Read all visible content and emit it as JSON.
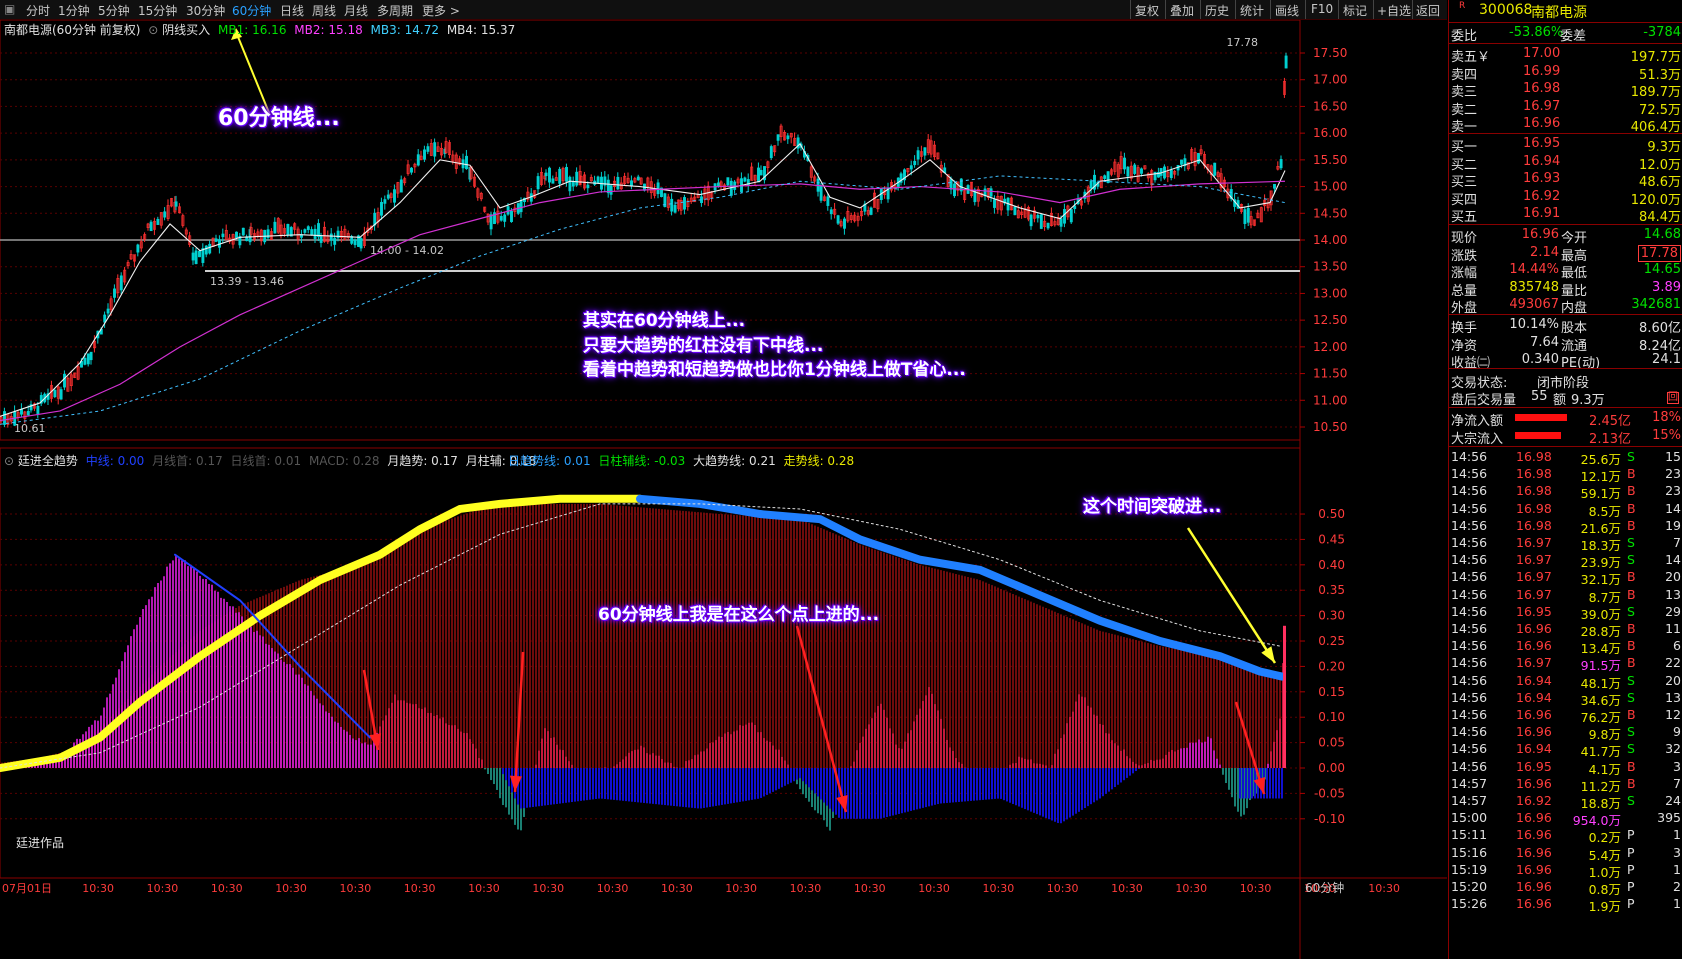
{
  "toolbar": {
    "periods": [
      "分时",
      "1分钟",
      "5分钟",
      "15分钟",
      "30分钟",
      "60分钟",
      "日线",
      "周线",
      "月线",
      "多周期",
      "更多 >"
    ],
    "active": "60分钟",
    "right": [
      "复权",
      "叠加",
      "历史",
      "统计",
      "画线",
      "F10",
      "标记",
      "+自选",
      "返回"
    ]
  },
  "main": {
    "title": "南都电源(60分钟 前复权)",
    "indicator": "阴线买入",
    "mb1": "MB1: 16.16",
    "mb2": "MB2: 15.18",
    "mb3": "MB3: 14.72",
    "mb4": "MB4: 15.37",
    "high_label": "17.78",
    "low_label": "10.61",
    "level1": "14.00 - 14.02",
    "level2": "13.39 - 13.46",
    "price_axis": [
      "17.50",
      "17.00",
      "16.50",
      "16.00",
      "15.50",
      "15.00",
      "14.50",
      "14.00",
      "13.50",
      "13.00",
      "12.50",
      "12.00",
      "11.50",
      "11.00",
      "10.50"
    ]
  },
  "sub": {
    "name": "廷进全趋势",
    "legend_dim": [
      "中线: 0.00",
      "月线首: 0.17",
      "日线首: 0.01",
      "MACD: 0.28"
    ],
    "legend1": "月趋势: 0.17",
    "legend2": "月柱辅: 0.18",
    "legend3": "日趋势线: 0.01",
    "legend4": "日柱辅线: -0.03",
    "legend5": "大趋势线: 0.21",
    "legend6": "走势线: 0.28",
    "axis": [
      "0.50",
      "0.45",
      "0.40",
      "0.35",
      "0.30",
      "0.25",
      "0.20",
      "0.15",
      "0.10",
      "0.05",
      "0.00",
      "-0.05",
      "-0.10"
    ],
    "watermark": "廷进作品"
  },
  "xaxis": {
    "labels": [
      "07月01日",
      "10:30",
      "10:30",
      "10:30",
      "10:30",
      "10:30",
      "10:30",
      "10:30",
      "10:30",
      "10:30",
      "10:30",
      "10:30",
      "10:30",
      "10:30",
      "10:30",
      "10:30",
      "10:30",
      "10:30",
      "10:30",
      "10:30",
      "10:30",
      "10:30"
    ],
    "period": "60分钟"
  },
  "annotations": {
    "a1": "60分钟线...",
    "a2": "其实在60分钟线上...",
    "a3": "只要大趋势的红柱没有下中线...",
    "a4": "看着中趋势和短趋势做也比你1分钟线上做T省心...",
    "a5": "60分钟线上我是在这么个点上进的...",
    "a6": "这个时间突破进..."
  },
  "stock": {
    "code": "300068",
    "name": "南都电源",
    "weibi_label": "委比",
    "weibi": "-53.86%",
    "weicha_label": "委差",
    "weicha": "-3784",
    "asks": [
      {
        "label": "卖五￥",
        "price": "17.00",
        "vol": "197.7万"
      },
      {
        "label": "卖四",
        "price": "16.99",
        "vol": "51.3万"
      },
      {
        "label": "卖三",
        "price": "16.98",
        "vol": "189.7万"
      },
      {
        "label": "卖二",
        "price": "16.97",
        "vol": "72.5万"
      },
      {
        "label": "卖一",
        "price": "16.96",
        "vol": "406.4万"
      }
    ],
    "bids": [
      {
        "label": "买一",
        "price": "16.95",
        "vol": "9.3万"
      },
      {
        "label": "买二",
        "price": "16.94",
        "vol": "12.0万"
      },
      {
        "label": "买三",
        "price": "16.93",
        "vol": "48.6万"
      },
      {
        "label": "买四",
        "price": "16.92",
        "vol": "120.0万"
      },
      {
        "label": "买五",
        "price": "16.91",
        "vol": "84.4万"
      }
    ],
    "quote": [
      {
        "l1": "现价",
        "v1": "16.96",
        "l2": "今开",
        "v2": "14.68"
      },
      {
        "l1": "涨跌",
        "v1": "2.14",
        "l2": "最高",
        "v2": "17.78"
      },
      {
        "l1": "涨幅",
        "v1": "14.44%",
        "l2": "最低",
        "v2": "14.65"
      },
      {
        "l1": "总量",
        "v1": "835748",
        "l2": "量比",
        "v2": "3.89"
      },
      {
        "l1": "外盘",
        "v1": "493067",
        "l2": "内盘",
        "v2": "342681"
      }
    ],
    "fund": [
      {
        "l1": "换手",
        "v1": "10.14%",
        "l2": "股本",
        "v2": "8.60亿"
      },
      {
        "l1": "净资",
        "v1": "7.64",
        "l2": "流通",
        "v2": "8.24亿"
      },
      {
        "l1": "收益㈡",
        "v1": "0.340",
        "l2": "PE(动)",
        "v2": "24.1"
      }
    ],
    "status_label": "交易状态:",
    "status": "闭市阶段",
    "after_label": "盘后交易量",
    "after_vol": "55",
    "after_amt_label": "额",
    "after_amt": "9.3万",
    "flow": [
      {
        "label": "净流入额",
        "value": "2.45亿",
        "pct": "18%"
      },
      {
        "label": "大宗流入",
        "value": "2.13亿",
        "pct": "15%"
      }
    ],
    "ticks": [
      [
        "14:56",
        "16.98",
        "25.6万",
        "S",
        "15"
      ],
      [
        "14:56",
        "16.98",
        "12.1万",
        "B",
        "23"
      ],
      [
        "14:56",
        "16.98",
        "59.1万",
        "B",
        "23"
      ],
      [
        "14:56",
        "16.98",
        "8.5万",
        "B",
        "14"
      ],
      [
        "14:56",
        "16.98",
        "21.6万",
        "B",
        "19"
      ],
      [
        "14:56",
        "16.97",
        "18.3万",
        "S",
        "7"
      ],
      [
        "14:56",
        "16.97",
        "23.9万",
        "S",
        "14"
      ],
      [
        "14:56",
        "16.97",
        "32.1万",
        "B",
        "20"
      ],
      [
        "14:56",
        "16.97",
        "8.7万",
        "B",
        "13"
      ],
      [
        "14:56",
        "16.95",
        "39.0万",
        "S",
        "29"
      ],
      [
        "14:56",
        "16.96",
        "28.8万",
        "B",
        "11"
      ],
      [
        "14:56",
        "16.96",
        "13.4万",
        "B",
        "6"
      ],
      [
        "14:56",
        "16.97",
        "91.5万",
        "B",
        "22"
      ],
      [
        "14:56",
        "16.94",
        "48.1万",
        "S",
        "20"
      ],
      [
        "14:56",
        "16.94",
        "34.6万",
        "S",
        "13"
      ],
      [
        "14:56",
        "16.96",
        "76.2万",
        "B",
        "12"
      ],
      [
        "14:56",
        "16.96",
        "9.8万",
        "S",
        "9"
      ],
      [
        "14:56",
        "16.94",
        "41.7万",
        "S",
        "32"
      ],
      [
        "14:56",
        "16.95",
        "4.1万",
        "B",
        "3"
      ],
      [
        "14:57",
        "16.96",
        "11.2万",
        "B",
        "7"
      ],
      [
        "14:57",
        "16.92",
        "18.8万",
        "S",
        "24"
      ],
      [
        "15:00",
        "16.96",
        "954.0万",
        "",
        "395"
      ],
      [
        "15:11",
        "16.96",
        "0.2万",
        "P",
        "1"
      ],
      [
        "15:16",
        "16.96",
        "5.4万",
        "P",
        "3"
      ],
      [
        "15:19",
        "16.96",
        "1.0万",
        "P",
        "1"
      ],
      [
        "15:20",
        "16.96",
        "0.8万",
        "P",
        "2"
      ],
      [
        "15:26",
        "16.96",
        "1.9万",
        "P",
        "1"
      ]
    ]
  }
}
